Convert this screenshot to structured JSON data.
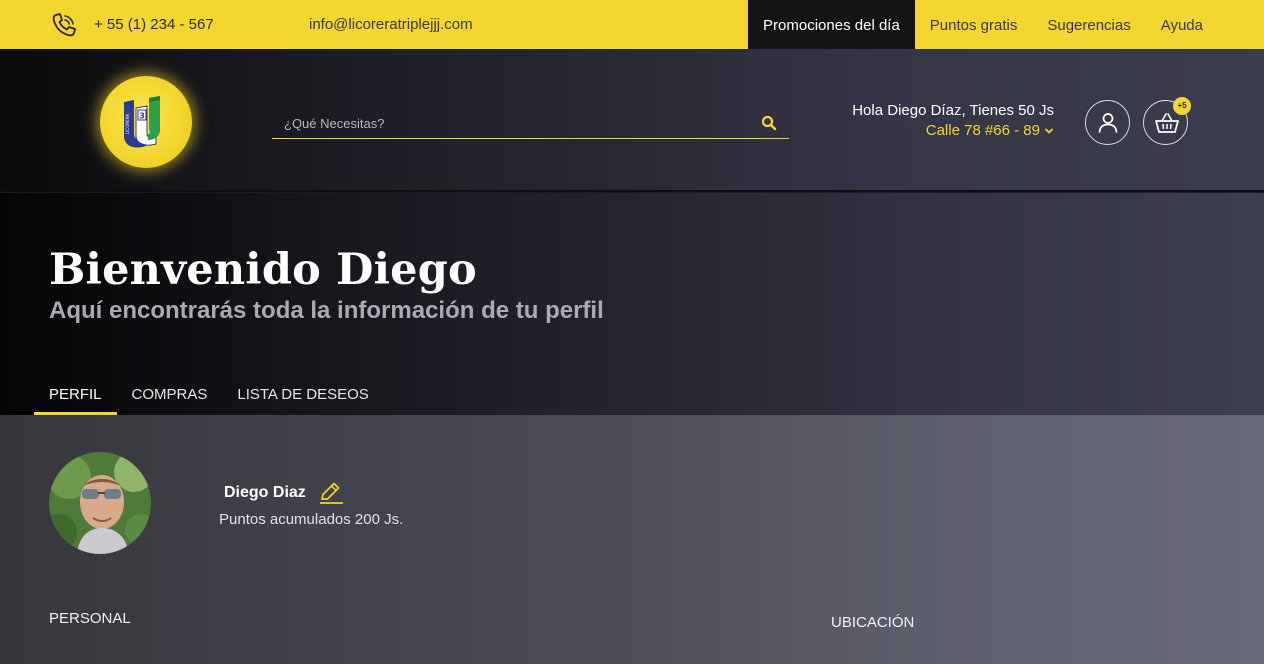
{
  "topbar": {
    "phone": "+ 55 (1) 234 - 567",
    "email": "info@licoreratriplejjj.com",
    "nav": [
      {
        "label": "Promociones del día",
        "active": true
      },
      {
        "label": "Puntos gratis",
        "active": false
      },
      {
        "label": "Sugerencias",
        "active": false
      },
      {
        "label": "Ayuda",
        "active": false
      }
    ],
    "phone_icon": "phone-icon"
  },
  "header": {
    "search_placeholder": "¿Qué Necesitas?",
    "greeting": "Hola Diego Díaz, Tienes 50 Js",
    "address": "Calle 78 #66 - 89",
    "cart_badge": "+5",
    "logo_text": "LICORERA JJJ 3",
    "colors": {
      "accent": "#f3d630",
      "dark": "#141414"
    }
  },
  "hero": {
    "title": "Bienvenido Diego",
    "subtitle": "Aquí encontrarás toda la información de tu perfil",
    "tabs": [
      {
        "label": "PERFIL",
        "active": true
      },
      {
        "label": "COMPRAS",
        "active": false
      },
      {
        "label": "LISTA DE DESEOS",
        "active": false
      }
    ]
  },
  "profile": {
    "name": "Diego Diaz",
    "points": "Puntos acumulados 200 Js.",
    "sections": {
      "personal": "PERSONAL",
      "location": "UBICACIÓN"
    }
  }
}
